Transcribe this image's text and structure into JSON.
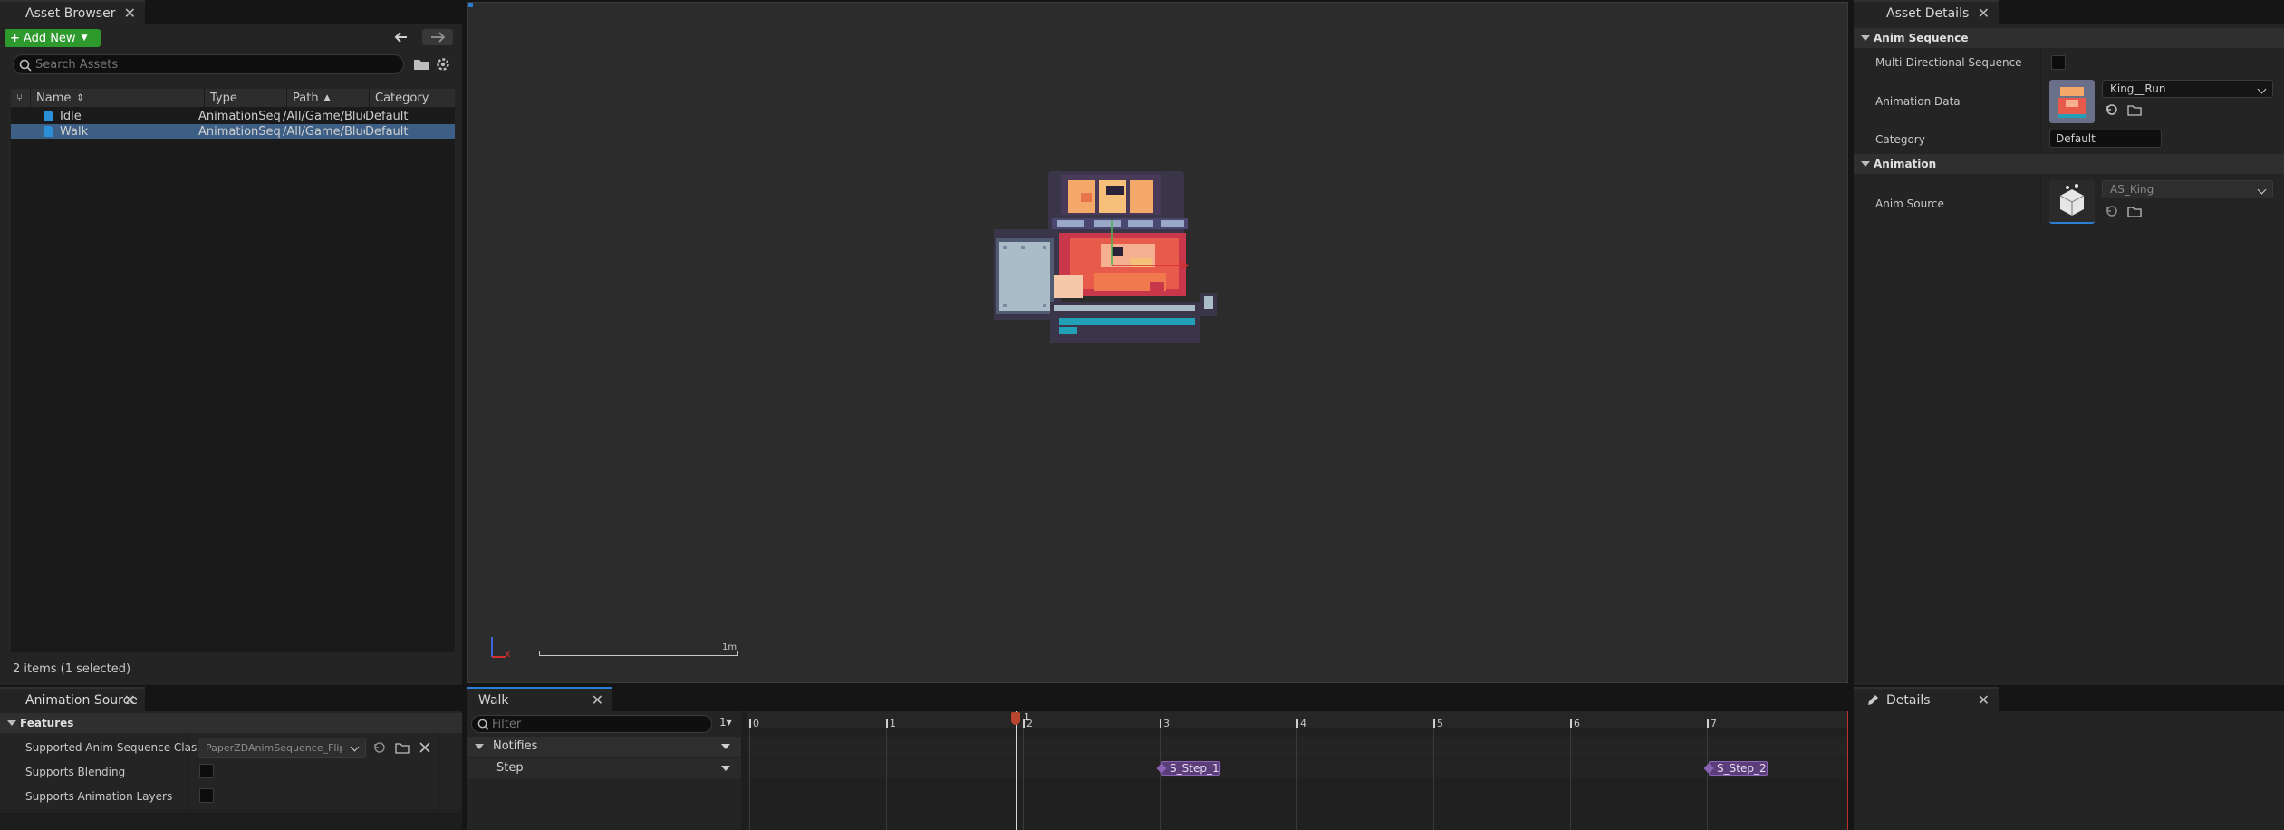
{
  "asset_browser": {
    "tab_title": "Asset Browser",
    "add_new_label": "Add New",
    "search_placeholder": "Search Assets",
    "columns": [
      "Name",
      "Type",
      "Path",
      "Category"
    ],
    "rows": [
      {
        "name": "Idle",
        "type": "AnimationSequence",
        "path": "/All/Game/Blueprints",
        "category": "Default",
        "selected": false
      },
      {
        "name": "Walk",
        "type": "AnimationSequence",
        "path": "/All/Game/Blueprints",
        "category": "Default",
        "selected": true
      }
    ],
    "status": "2 items (1 selected)"
  },
  "viewport": {
    "scale_label": "1m",
    "axis_x_label": "x"
  },
  "asset_details": {
    "tab_title": "Asset Details",
    "sections": {
      "anim_sequence": "Anim Sequence",
      "animation": "Animation"
    },
    "props": {
      "multi_directional": "Multi-Directional Sequence",
      "animation_data": "Animation Data",
      "animation_data_value": "King__Run",
      "category": "Category",
      "category_value": "Default",
      "anim_source": "Anim Source",
      "anim_source_value": "AS_King"
    }
  },
  "animation_source": {
    "tab_title": "Animation Source",
    "section": "Features",
    "props": {
      "supported_class": "Supported Anim Sequence Class",
      "supported_class_value": "PaperZDAnimSequence_Flipbook",
      "supports_blending": "Supports Blending",
      "supports_layers": "Supports Animation Layers"
    }
  },
  "timeline": {
    "tab_title": "Walk",
    "filter_placeholder": "Filter",
    "track_group": "Notifies",
    "track": "Step",
    "frame_ticks": [
      "0",
      "1",
      "2",
      "3",
      "4",
      "5",
      "6",
      "7"
    ],
    "playhead_frame": 2,
    "playhead_label": "1",
    "notifies": [
      {
        "label": "S_Step_1",
        "frame": 3
      },
      {
        "label": "S_Step_2",
        "frame": 7
      }
    ]
  },
  "details": {
    "tab_title": "Details"
  },
  "colors": {
    "accent_green": "#2e9a2e",
    "notify_purple": "#5a3d79",
    "selection_blue": "#3d5f85"
  }
}
